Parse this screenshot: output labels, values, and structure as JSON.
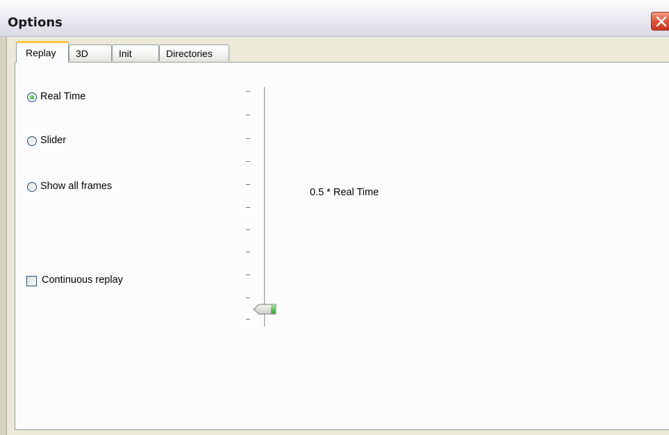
{
  "window": {
    "title": "Options"
  },
  "tabs": [
    {
      "label": "Replay",
      "active": true
    },
    {
      "label": "3D",
      "active": false
    },
    {
      "label": "Init",
      "active": false
    },
    {
      "label": "Directories",
      "active": false
    }
  ],
  "replay": {
    "radio_options": [
      {
        "label": "Real Time",
        "checked": true
      },
      {
        "label": "Slider",
        "checked": false
      },
      {
        "label": "Show all frames",
        "checked": false
      }
    ],
    "continuous_replay": {
      "label": "Continuous replay",
      "checked": false
    },
    "speed_slider": {
      "ticks": 11,
      "position_index": 10
    },
    "speed_label": "0.5 * Real Time"
  },
  "colors": {
    "active_tab_accent": "#ffc83c",
    "close_button": "#e2563a",
    "radio_dot": "#21a121"
  }
}
